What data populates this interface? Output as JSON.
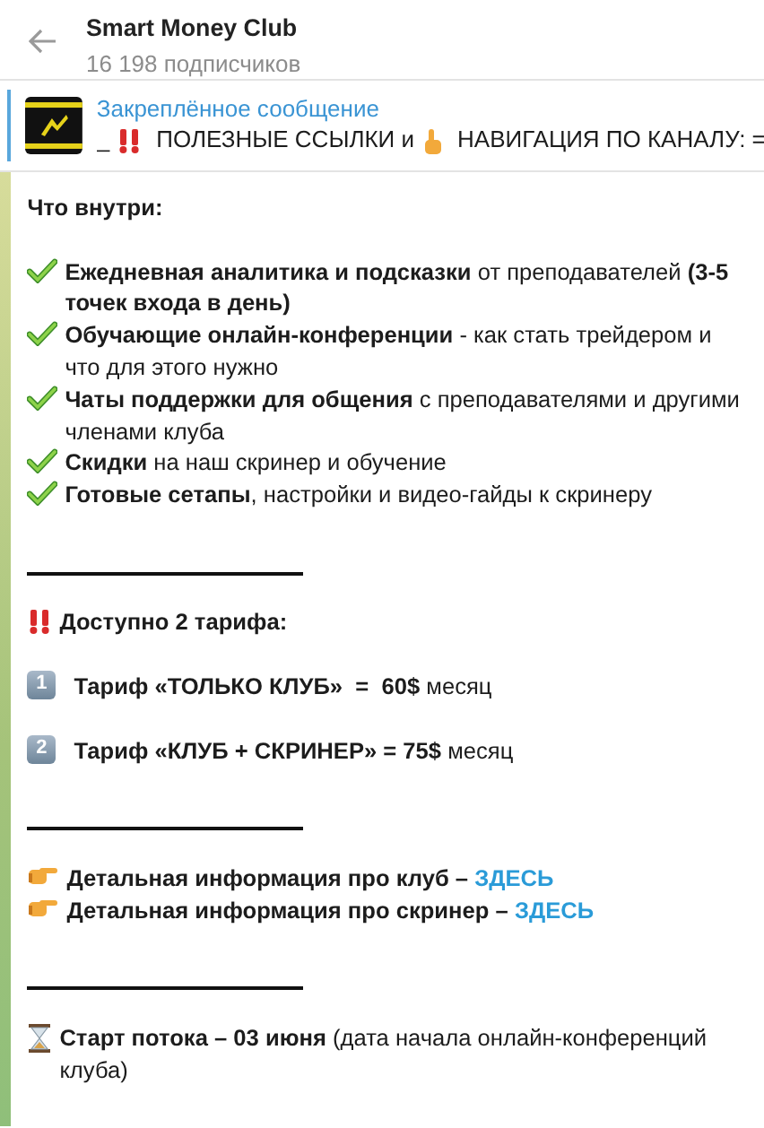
{
  "header": {
    "title": "Smart Money Club",
    "subtitle": "16 198 подписчиков"
  },
  "pinned": {
    "label": "Закреплённое сообщение",
    "segments": [
      {
        "kind": "text",
        "text": "_"
      },
      {
        "kind": "alarm"
      },
      {
        "kind": "text",
        "text": "ПОЛЕЗНЫЕ ССЫЛКИ и"
      },
      {
        "kind": "handup"
      },
      {
        "kind": "text",
        "text": "НАВИГАЦИЯ ПО КАНАЛУ:  ="
      }
    ]
  },
  "message": [
    {
      "kind": "heading",
      "text": "Что внутри:"
    },
    {
      "kind": "blank"
    },
    {
      "kind": "check",
      "text": "**Ежедневная аналитика и подсказки** от преподавателей **(3-5 точек входа в день)**"
    },
    {
      "kind": "check",
      "text": "**Обучающие онлайн-конференции** - как стать трейдером и что для этого нужно"
    },
    {
      "kind": "check",
      "text": "**Чаты поддержки для общения** с преподавателями и другими членами клуба"
    },
    {
      "kind": "check",
      "text": "**Скидки** на наш скринер и обучение"
    },
    {
      "kind": "check",
      "text": "**Готовые сетапы**, настройки и видео-гайды к скринеру"
    },
    {
      "kind": "blank"
    },
    {
      "kind": "rule"
    },
    {
      "kind": "blank"
    },
    {
      "kind": "alarm",
      "text": "**Доступно 2 тарифа:**"
    },
    {
      "kind": "blank"
    },
    {
      "kind": "keycap",
      "key": "1",
      "text": "**Тариф «ТОЛЬКО КЛУБ»  =  60$** месяц"
    },
    {
      "kind": "blank"
    },
    {
      "kind": "keycap",
      "key": "2",
      "text": "**Тариф «КЛУБ + СКРИНЕР» = 75$** месяц"
    },
    {
      "kind": "blank"
    },
    {
      "kind": "rule"
    },
    {
      "kind": "blank"
    },
    {
      "kind": "pointer",
      "text": "**Детальная информация про клуб –**",
      "link": "ЗДЕСЬ"
    },
    {
      "kind": "pointer",
      "text": "**Детальная информация про скринер –**",
      "link": "ЗДЕСЬ"
    },
    {
      "kind": "blank"
    },
    {
      "kind": "rule"
    },
    {
      "kind": "blank"
    },
    {
      "kind": "hourglass",
      "text": "**Старт потока – 03 июня** (дата начала онлайн-конференций клуба)"
    }
  ]
}
